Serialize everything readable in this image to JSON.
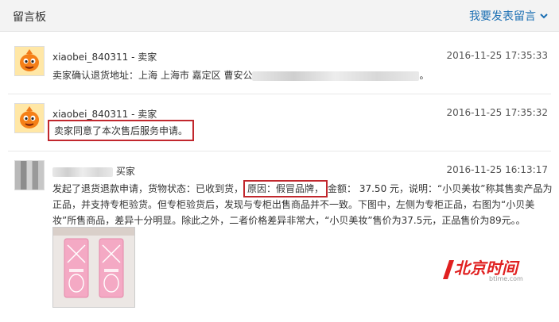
{
  "header": {
    "title": "留言板",
    "action_label": "我要发表留言"
  },
  "messages": [
    {
      "author": "xiaobei_840311 - 卖家",
      "time": "2016-11-25 17:35:33",
      "text_prefix": "卖家确认退货地址：上海 上海市 嘉定区 曹安公",
      "text_suffix": "。"
    },
    {
      "author": "xiaobei_840311 - 卖家",
      "time": "2016-11-25 17:35:32",
      "text": "卖家同意了本次售后服务申请。"
    },
    {
      "author_suffix": "买家",
      "time": "2016-11-25 16:13:17",
      "line1_a": "发起了退货退款申请，货物状态：已收到货，",
      "line1_highlight": "原因：假冒品牌，",
      "line1_b": "金额： 37.50 元，说明：“小贝美妆”称其售卖产品为",
      "line2": "正品，并支持专柜验货。但专柜验货后，发现与专柜出售商品并不一致。下图中，左侧为专柜正品，右图为“小贝美",
      "line3": "妆”所售商品，差异十分明显。除此之外，二者价格差异非常大，“小贝美妆”售价为37.5元，正品售价为89元。。"
    }
  ],
  "watermark": {
    "brand": "北京时间",
    "url": "btime.com"
  },
  "colors": {
    "link": "#1b6fb3",
    "highlight_border": "#c1272d",
    "watermark_red": "#e02020"
  }
}
